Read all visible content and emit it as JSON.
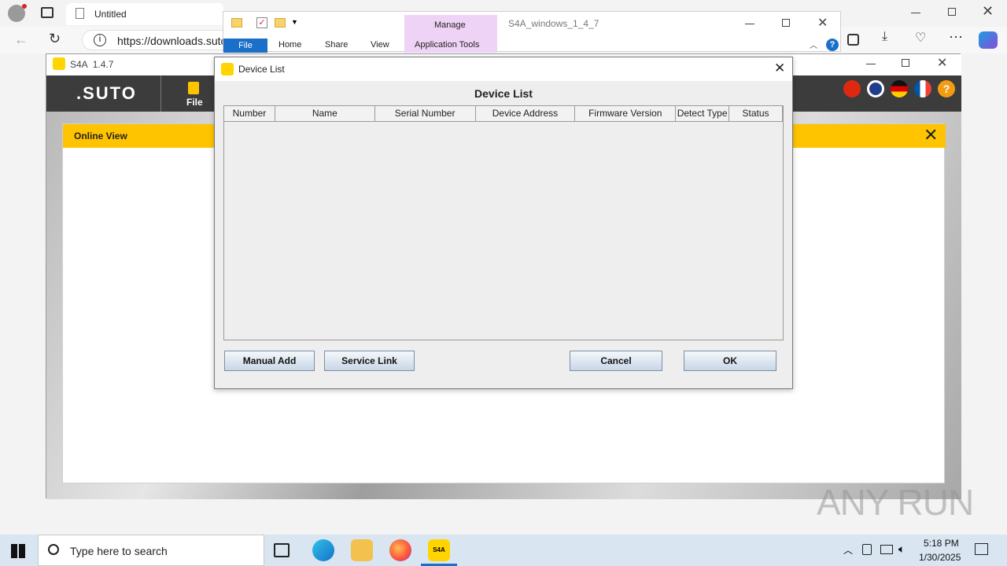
{
  "browser": {
    "tab_title": "Untitled",
    "url": "https://downloads.suto"
  },
  "explorer": {
    "title": "S4A_windows_1_4_7",
    "tabs": [
      "File",
      "Home",
      "Share",
      "View"
    ],
    "manage_label": "Manage",
    "app_tools_label": "Application Tools"
  },
  "app": {
    "title": "S4A  1.4.7",
    "logo": ".SUTO",
    "file_label": "File",
    "online_view_label": "Online View",
    "languages": [
      "zh",
      "en",
      "de",
      "fr"
    ],
    "help_label": "?"
  },
  "dialog": {
    "title": "Device List",
    "heading": "Device List",
    "columns": [
      "Number",
      "Name",
      "Serial Number",
      "Device Address",
      "Firmware Version",
      "Detect Type",
      "Status"
    ],
    "rows": [],
    "buttons": {
      "manual_add": "Manual Add",
      "service_link": "Service Link",
      "cancel": "Cancel",
      "ok": "OK"
    }
  },
  "taskbar": {
    "search_placeholder": "Type here to search",
    "time": "5:18 PM",
    "date": "1/30/2025",
    "s4a_label": "S4A"
  },
  "watermark": "ANY RUN",
  "colors": {
    "accent_yellow": "#ffc400",
    "explorer_blue": "#1a6fc9",
    "manage_purple": "#efd3f6"
  }
}
